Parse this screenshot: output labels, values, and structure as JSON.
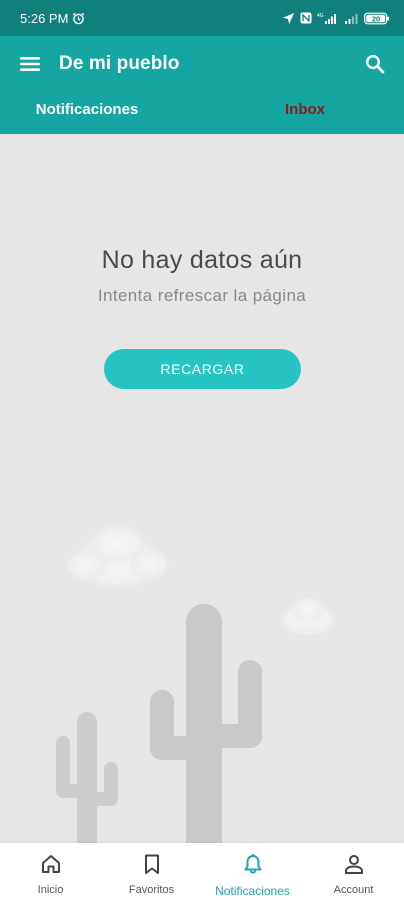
{
  "status_bar": {
    "time": "5:26 PM",
    "battery": "20",
    "network": "4G"
  },
  "app_bar": {
    "title": "De mi pueblo",
    "tabs": [
      {
        "label": "Notificaciones",
        "active": true
      },
      {
        "label": "Inbox",
        "active": false
      }
    ]
  },
  "empty_state": {
    "title": "No hay datos aún",
    "subtitle": "Intenta refrescar la página",
    "button_label": "RECARGAR"
  },
  "bottom_nav": {
    "items": [
      {
        "label": "Inicio",
        "icon": "home-icon"
      },
      {
        "label": "Favoritos",
        "icon": "bookmark-icon"
      },
      {
        "label": "Notificaciones",
        "icon": "bell-icon",
        "active": true
      },
      {
        "label": "Account",
        "icon": "person-icon"
      }
    ]
  },
  "colors": {
    "status_bar": "#117f7a",
    "app_bar": "#16a6a1",
    "accent": "#26c4c2",
    "active_nav": "#1aa9a6",
    "inbox_tab_text": "#8b1a1a",
    "background": "#e6e6e6"
  }
}
